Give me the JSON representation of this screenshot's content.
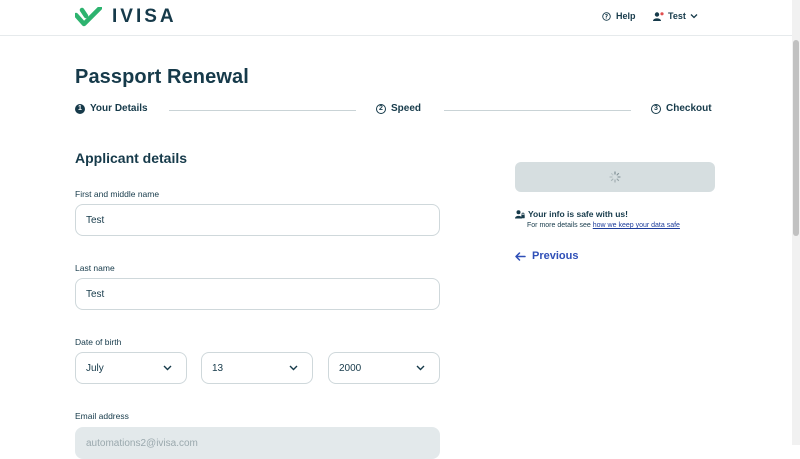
{
  "header": {
    "brand": "IVISA",
    "help_label": "Help",
    "user_label": "Test"
  },
  "page": {
    "title": "Passport Renewal"
  },
  "steps": [
    {
      "number": "1",
      "label": "Your Details",
      "active": true
    },
    {
      "number": "2",
      "label": "Speed",
      "active": false
    },
    {
      "number": "3",
      "label": "Checkout",
      "active": false
    }
  ],
  "form": {
    "section_title": "Applicant details",
    "first_name": {
      "label": "First and middle name",
      "value": "Test"
    },
    "last_name": {
      "label": "Last name",
      "value": "Test"
    },
    "dob": {
      "label": "Date of birth",
      "month": "July",
      "day": "13",
      "year": "2000"
    },
    "email": {
      "label": "Email address",
      "value": "automations2@ivisa.com"
    }
  },
  "sidebar": {
    "safe_title": "Your info is safe with us!",
    "safe_note": "For more details see",
    "safe_link": "how we keep your data safe",
    "previous_label": "Previous"
  },
  "colors": {
    "brand_green": "#2db36f",
    "text_primary": "#163a4a",
    "link_blue": "#2f4fb7",
    "disabled_button": "#d6dee0"
  },
  "icons": [
    "ivisa-check-logo-icon",
    "help-circle-icon",
    "user-icon",
    "chevron-down-icon",
    "loading-spinner-icon",
    "user-lock-icon",
    "arrow-left-icon"
  ]
}
